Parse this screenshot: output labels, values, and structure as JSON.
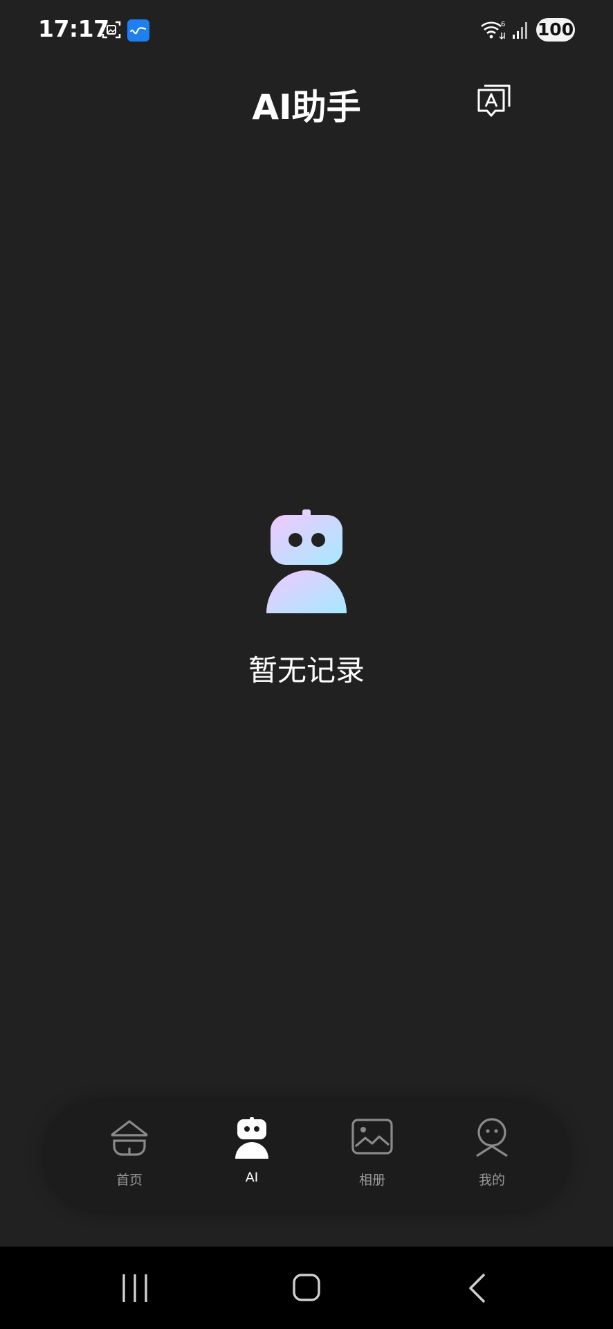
{
  "status_bar": {
    "time": "17:17",
    "battery": "100",
    "icons": [
      "screenshot-icon",
      "app-notification-icon",
      "wifi-icon",
      "signal-icon"
    ]
  },
  "header": {
    "title": "AI助手",
    "action_icon": "translate-icon"
  },
  "empty_state": {
    "icon": "robot-icon",
    "message": "暂无记录"
  },
  "tab_bar": {
    "active": "ai",
    "tabs": [
      {
        "id": "home",
        "label": "首页",
        "icon": "home-icon"
      },
      {
        "id": "ai",
        "label": "AI",
        "icon": "robot-icon"
      },
      {
        "id": "album",
        "label": "相册",
        "icon": "image-icon"
      },
      {
        "id": "mine",
        "label": "我的",
        "icon": "profile-icon"
      }
    ]
  },
  "nav_bar": {
    "buttons": [
      "recent-apps-icon",
      "home-button-icon",
      "back-icon"
    ]
  },
  "colors": {
    "background": "#212121",
    "tab_bar": "#1c1c1c",
    "nav_bar": "#000000",
    "text_primary": "#ffffff",
    "text_secondary": "#9a9a9a",
    "robot_gradient_start": "#f1c8ff",
    "robot_gradient_end": "#a6e9ff"
  }
}
